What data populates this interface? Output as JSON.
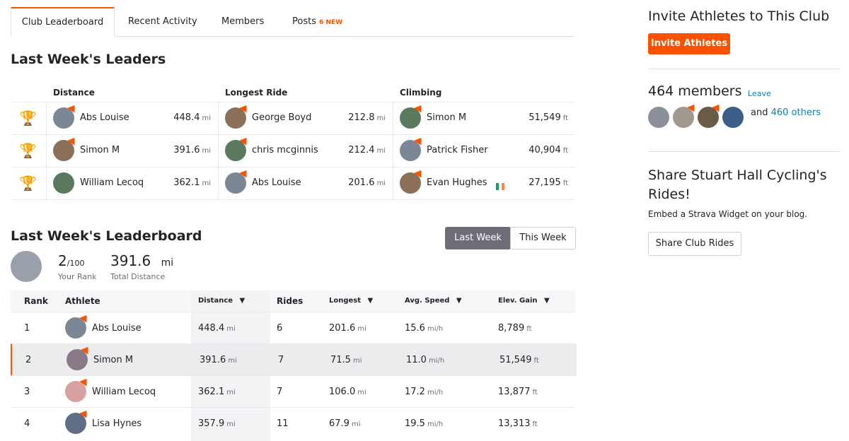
{
  "tabs": [
    {
      "label": "Club Leaderboard"
    },
    {
      "label": "Recent Activity"
    },
    {
      "label": "Members"
    },
    {
      "label": "Posts",
      "badge": "6 NEW"
    }
  ],
  "leaders": {
    "title": "Last Week's Leaders",
    "columns": [
      "Distance",
      "Longest Ride",
      "Climbing"
    ],
    "rows": [
      {
        "trophy": "1",
        "distance": {
          "name": "Abs Louise",
          "value": "448.4",
          "unit": "mi"
        },
        "longest": {
          "name": "George Boyd",
          "value": "212.8",
          "unit": "mi"
        },
        "climbing": {
          "name": "Simon M",
          "value": "51,549",
          "unit": "ft"
        }
      },
      {
        "trophy": "2",
        "distance": {
          "name": "Simon M",
          "value": "391.6",
          "unit": "mi"
        },
        "longest": {
          "name": "chris mcginnis",
          "value": "212.4",
          "unit": "mi"
        },
        "climbing": {
          "name": "Patrick Fisher",
          "value": "40,904",
          "unit": "ft"
        }
      },
      {
        "trophy": "3",
        "distance": {
          "name": "William Lecoq",
          "value": "362.1",
          "unit": "mi"
        },
        "longest": {
          "name": "Abs Louise",
          "value": "201.6",
          "unit": "mi"
        },
        "climbing": {
          "name": "Evan Hughes",
          "flag": "IE",
          "value": "27,195",
          "unit": "ft"
        }
      }
    ]
  },
  "leaderboard": {
    "title": "Last Week's Leaderboard",
    "toggle": {
      "last_week": "Last Week",
      "this_week": "This Week"
    },
    "my_rank": {
      "rank": "2",
      "of": "/100",
      "rank_label": "Your Rank",
      "distance": "391.6",
      "distance_unit": "mi",
      "distance_label": "Total Distance"
    },
    "headers": {
      "rank": "Rank",
      "athlete": "Athlete",
      "distance": "Distance",
      "rides": "Rides",
      "longest": "Longest",
      "avg_speed": "Avg. Speed",
      "elev": "Elev. Gain"
    },
    "sort_icon": "▼",
    "rows": [
      {
        "rank": "1",
        "name": "Abs Louise",
        "distance": "448.4",
        "rides": "6",
        "longest": "201.6",
        "speed": "15.6",
        "elev": "8,789"
      },
      {
        "rank": "2",
        "name": "Simon M",
        "distance": "391.6",
        "rides": "7",
        "longest": "71.5",
        "speed": "11.0",
        "elev": "51,549",
        "highlight": true
      },
      {
        "rank": "3",
        "name": "William Lecoq",
        "distance": "362.1",
        "rides": "7",
        "longest": "106.0",
        "speed": "17.2",
        "elev": "13,877"
      },
      {
        "rank": "4",
        "name": "Lisa Hynes",
        "distance": "357.9",
        "rides": "11",
        "longest": "67.9",
        "speed": "19.5",
        "elev": "13,313"
      }
    ],
    "units": {
      "mi": "mi",
      "speed": "mi/h",
      "ft": "ft"
    }
  },
  "sidebar": {
    "invite_title": "Invite Athletes to This Club",
    "invite_button": "Invite Athletes",
    "members_count": "464 members",
    "leave": "Leave",
    "and": "and",
    "others": "460 others",
    "share_title": "Share Stuart Hall Cycling's Rides!",
    "share_desc": "Embed a Strava Widget on your blog.",
    "share_button": "Share Club Rides"
  },
  "colors": {
    "accent": "#fc5200",
    "link": "#0a7fb5",
    "trophy": "#f5a623"
  }
}
